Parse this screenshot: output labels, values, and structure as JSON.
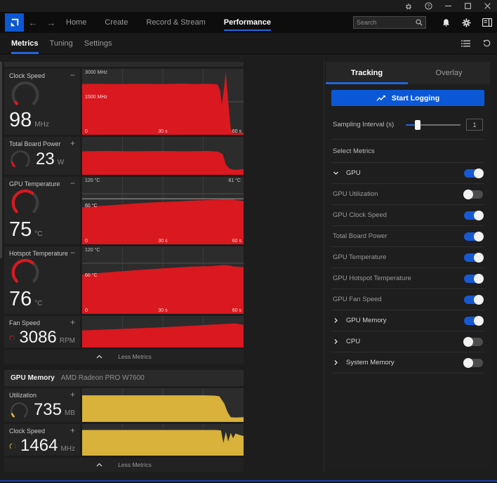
{
  "colors": {
    "red": "#d9181f",
    "yellow": "#d8b23a",
    "accent": "#2465dd",
    "button_blue": "#0b58d6"
  },
  "nav": {
    "items": [
      "Home",
      "Create",
      "Record & Stream",
      "Performance"
    ],
    "active": "Performance"
  },
  "search": {
    "placeholder": "Search"
  },
  "subtabs": {
    "items": [
      "Metrics",
      "Tuning",
      "Settings"
    ],
    "active": "Metrics"
  },
  "metrics": {
    "less_metrics_label": "Less Metrics",
    "cards": [
      {
        "label": "Clock Speed",
        "value": "98",
        "unit": "MHz",
        "collapse_glyph": "−",
        "gauge_pct": 3,
        "color": "red"
      },
      {
        "label": "Total Board Power",
        "value": "23",
        "unit": "W",
        "collapse_glyph": "+",
        "gauge_pct": 10,
        "color": "red"
      },
      {
        "label": "GPU Temperature",
        "value": "75",
        "unit": "°C",
        "collapse_glyph": "−",
        "gauge_pct": 63,
        "color": "red"
      },
      {
        "label": "Hotspot Temperature",
        "value": "76",
        "unit": "°C",
        "collapse_glyph": "−",
        "gauge_pct": 64,
        "color": "red"
      },
      {
        "label": "Fan Speed",
        "value": "3086",
        "unit": "RPM",
        "collapse_glyph": "+",
        "gauge_pct": 58,
        "color": "red"
      },
      {
        "label": "Utilization",
        "value": "735",
        "unit": "MB",
        "collapse_glyph": "+",
        "gauge_pct": 8,
        "color": "yellow"
      },
      {
        "label": "Clock Speed",
        "value": "1464",
        "unit": "MHz",
        "collapse_glyph": "+",
        "gauge_pct": 42,
        "color": "yellow"
      }
    ],
    "memory_section": {
      "title": "GPU Memory",
      "subtitle": "AMD Radeon PRO W7600"
    }
  },
  "tracking_panel": {
    "tabs": [
      {
        "label": "Tracking",
        "active": true
      },
      {
        "label": "Overlay",
        "active": false
      }
    ],
    "start_logging_label": "Start Logging",
    "sampling_label": "Sampling Interval (s)",
    "sampling_value": "1",
    "select_metrics_label": "Select Metrics",
    "rows": [
      {
        "slug": "gpu",
        "label": "GPU",
        "chevron": "down",
        "toggle": true,
        "parent": true
      },
      {
        "slug": "gpu-utilization",
        "label": "GPU Utilization",
        "toggle": false
      },
      {
        "slug": "gpu-clock-speed",
        "label": "GPU Clock Speed",
        "toggle": true
      },
      {
        "slug": "total-board-power",
        "label": "Total Board Power",
        "toggle": true
      },
      {
        "slug": "gpu-temperature",
        "label": "GPU Temperature",
        "toggle": true
      },
      {
        "slug": "gpu-hotspot-temperature",
        "label": "GPU Hotspot Temperature",
        "toggle": true
      },
      {
        "slug": "gpu-fan-speed",
        "label": "GPU Fan Speed",
        "toggle": true
      },
      {
        "slug": "gpu-memory",
        "label": "GPU Memory",
        "chevron": "right",
        "toggle": true,
        "parent": true
      },
      {
        "slug": "cpu",
        "label": "CPU",
        "chevron": "right",
        "toggle": false,
        "parent": true
      },
      {
        "slug": "system-memory",
        "label": "System Memory",
        "chevron": "right",
        "toggle": false,
        "parent": true
      }
    ]
  },
  "chart_data": [
    {
      "id": 0,
      "type": "area",
      "title": "GPU Clock Speed",
      "color": "#d9181f",
      "ylim": [
        0,
        3000
      ],
      "label_top_left": "3000 MHz",
      "label_mid_left": "1500 MHz",
      "xticks": {
        "left": "0",
        "center": "30 s",
        "right": "60 s"
      },
      "gridlines": [
        0.5
      ],
      "points": [
        [
          0,
          2310
        ],
        [
          8,
          2320
        ],
        [
          20,
          2310
        ],
        [
          35,
          2320
        ],
        [
          50,
          2310
        ],
        [
          62,
          2325
        ],
        [
          70,
          2310
        ],
        [
          78,
          2320
        ],
        [
          82,
          2310
        ],
        [
          84,
          2290
        ],
        [
          85.5,
          2000
        ],
        [
          86.5,
          1380
        ],
        [
          88,
          2180
        ],
        [
          89,
          2860
        ],
        [
          90.5,
          1500
        ],
        [
          92,
          300
        ],
        [
          93.5,
          80
        ],
        [
          100,
          90
        ]
      ]
    },
    {
      "id": 1,
      "type": "area",
      "title": "Total Board Power",
      "color": "#d9181f",
      "ylim": [
        0,
        100
      ],
      "points": [
        [
          0,
          62
        ],
        [
          15,
          63
        ],
        [
          30,
          62
        ],
        [
          50,
          63
        ],
        [
          65,
          62
        ],
        [
          78,
          63
        ],
        [
          84,
          61
        ],
        [
          87,
          55
        ],
        [
          89,
          28
        ],
        [
          91,
          17
        ],
        [
          94,
          13
        ],
        [
          97,
          14
        ],
        [
          100,
          15
        ]
      ]
    },
    {
      "id": 2,
      "type": "area",
      "title": "GPU Temperature",
      "color": "#d9181f",
      "ylim": [
        0,
        120
      ],
      "label_top_left": "120 °C",
      "label_top_right": "81 °C",
      "label_mid_left": "60 °C",
      "xticks": {
        "left": "0",
        "center": "30 s",
        "right": "60 s"
      },
      "gridlines": [
        0.75
      ],
      "marker_value": 81,
      "points": [
        [
          0,
          66
        ],
        [
          10,
          68
        ],
        [
          25,
          71
        ],
        [
          40,
          74
        ],
        [
          55,
          76
        ],
        [
          70,
          78
        ],
        [
          80,
          79
        ],
        [
          88,
          80
        ],
        [
          92,
          81
        ],
        [
          95,
          79
        ],
        [
          100,
          77
        ]
      ]
    },
    {
      "id": 3,
      "type": "area",
      "title": "Hotspot Temperature",
      "color": "#d9181f",
      "ylim": [
        0,
        120
      ],
      "label_top_left": "120 °C",
      "label_mid_left": "60 °C",
      "xticks": {
        "left": "0",
        "center": "30 s",
        "right": "60 s"
      },
      "gridlines": [
        0.75
      ],
      "points": [
        [
          0,
          70
        ],
        [
          12,
          73
        ],
        [
          30,
          77
        ],
        [
          50,
          81
        ],
        [
          68,
          84
        ],
        [
          80,
          85
        ],
        [
          88,
          87
        ],
        [
          91,
          86
        ],
        [
          94,
          84
        ],
        [
          100,
          83
        ]
      ]
    },
    {
      "id": 4,
      "type": "area",
      "title": "Fan Speed",
      "color": "#d9181f",
      "ylim": [
        0,
        100
      ],
      "points": [
        [
          0,
          54
        ],
        [
          15,
          57
        ],
        [
          30,
          60
        ],
        [
          45,
          63
        ],
        [
          60,
          67
        ],
        [
          72,
          70
        ],
        [
          82,
          73
        ],
        [
          90,
          75
        ],
        [
          95,
          76
        ],
        [
          100,
          72
        ]
      ]
    },
    {
      "id": 5,
      "type": "area",
      "title": "GPU Memory Utilization",
      "color": "#d8b23a",
      "ylim": [
        0,
        100
      ],
      "points": [
        [
          0,
          79
        ],
        [
          20,
          79
        ],
        [
          40,
          79
        ],
        [
          60,
          79
        ],
        [
          75,
          79
        ],
        [
          82,
          78
        ],
        [
          85,
          76
        ],
        [
          88,
          55
        ],
        [
          90,
          30
        ],
        [
          92,
          14
        ],
        [
          95,
          13
        ],
        [
          100,
          14
        ]
      ]
    },
    {
      "id": 6,
      "type": "area",
      "title": "GPU Memory Clock Speed",
      "color": "#d8b23a",
      "ylim": [
        0,
        100
      ],
      "points": [
        [
          0,
          81
        ],
        [
          20,
          81
        ],
        [
          40,
          81
        ],
        [
          60,
          81
        ],
        [
          75,
          81
        ],
        [
          83,
          81
        ],
        [
          86,
          80
        ],
        [
          87.5,
          40
        ],
        [
          89,
          75
        ],
        [
          90.5,
          45
        ],
        [
          92,
          72
        ],
        [
          93.5,
          55
        ],
        [
          95,
          70
        ],
        [
          97,
          66
        ],
        [
          100,
          62
        ]
      ]
    }
  ]
}
